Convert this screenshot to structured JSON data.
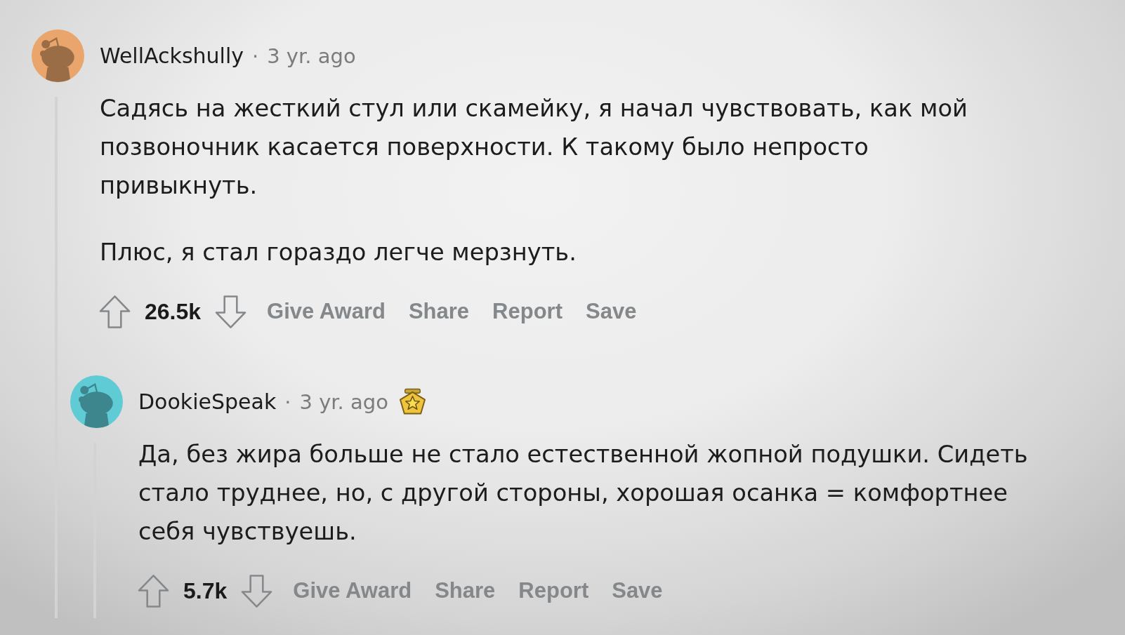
{
  "comments": [
    {
      "author": "WellAckshully",
      "separator": "·",
      "time": "3 yr. ago",
      "avatar": {
        "color": "#e9a56b"
      },
      "paragraphs": [
        "Садясь на жесткий стул или скамейку, я начал чувствовать, как мой позвоночник касается поверхности. К такому было непросто привыкнуть.",
        "Плюс, я стал гораздо легче мерзнуть."
      ],
      "score": "26.5k",
      "actions": [
        "Give Award",
        "Share",
        "Report",
        "Save"
      ],
      "replies": [
        {
          "author": "DookieSpeak",
          "separator": "·",
          "time": "3 yr. ago",
          "avatar": {
            "color": "#5ecbd5"
          },
          "awarded": true,
          "paragraphs": [
            "Да, без жира больше не стало естественной жопной подушки. Сидеть стало труднее, но, с другой стороны, хорошая осанка = комфортнее себя чувствуешь."
          ],
          "score": "5.7k",
          "actions": [
            "Give Award",
            "Share",
            "Report",
            "Save"
          ]
        }
      ]
    }
  ]
}
